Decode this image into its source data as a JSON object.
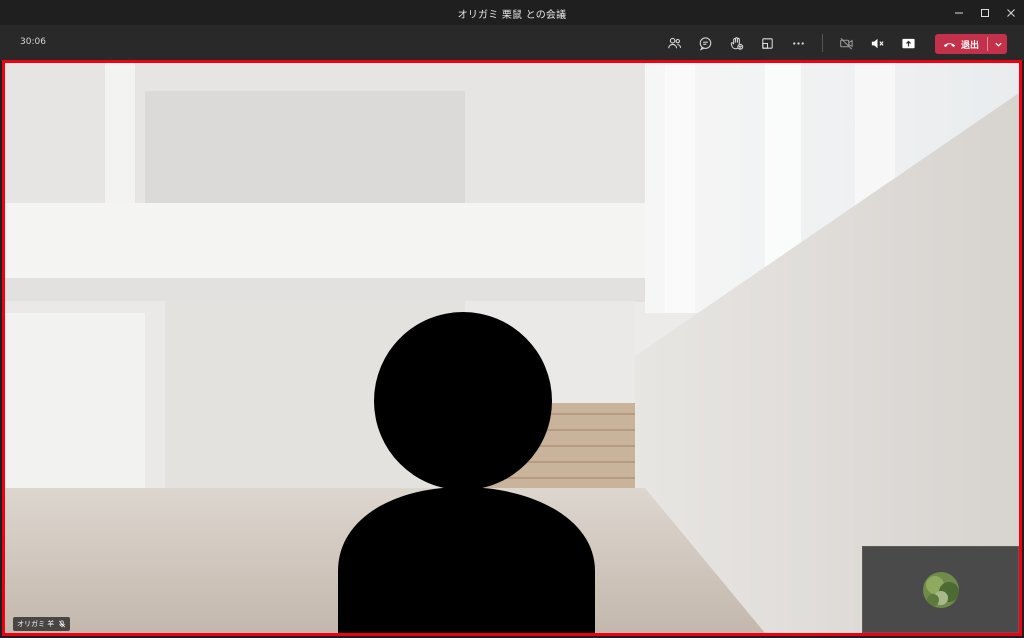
{
  "window": {
    "title": "オリガミ 栗鼠 との会議"
  },
  "toolbar": {
    "timer": "30:06",
    "leave_label": "退出"
  },
  "icons": {
    "participants": "people-icon",
    "chat": "chat-icon",
    "reactions": "reactions-icon",
    "rooms": "breakout-rooms-icon",
    "more": "more-icon",
    "camera": "camera-off-icon",
    "mic": "mic-off-icon",
    "share": "share-screen-icon",
    "leave": "phone-hangup-icon"
  },
  "stage": {
    "participant_name": "オリガミ 羊"
  },
  "colors": {
    "titlebar": "#1f1f1f",
    "toolbar": "#292929",
    "leave": "#c4314b",
    "highlight_border": "#f00012"
  }
}
